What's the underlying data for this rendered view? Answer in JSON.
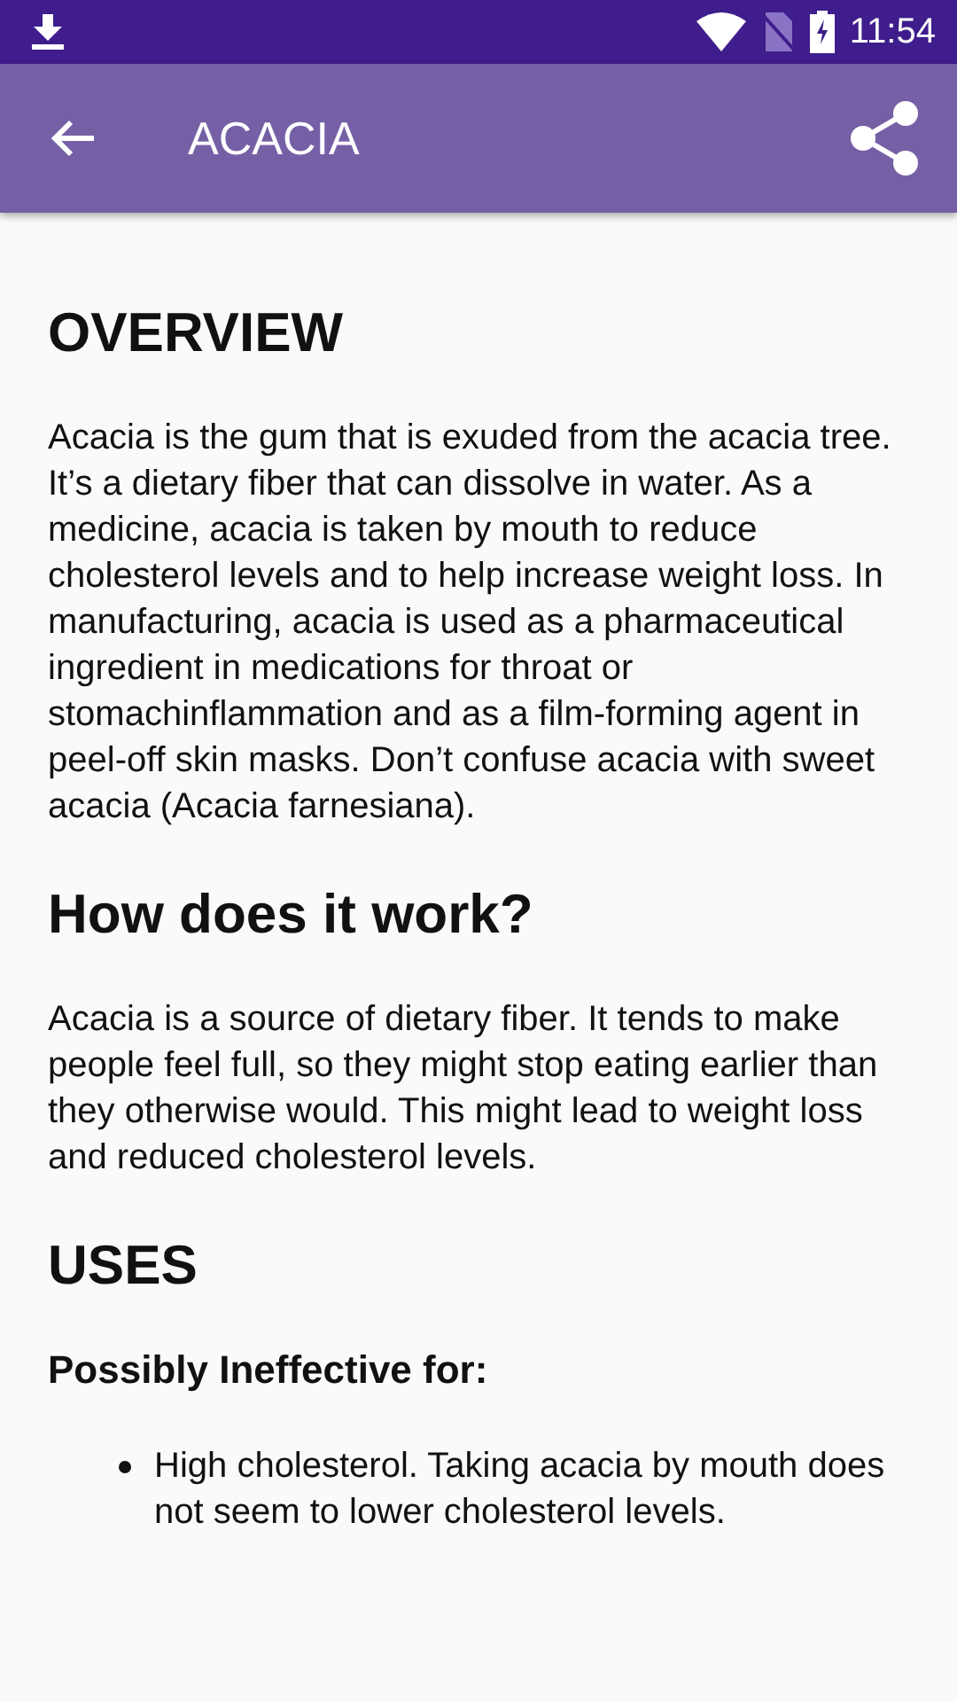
{
  "status_bar": {
    "time": "11:54"
  },
  "app_bar": {
    "title": "ACACIA"
  },
  "content": [
    {
      "kind": "heading",
      "text": "OVERVIEW"
    },
    {
      "kind": "paragraph",
      "text": "Acacia is the gum that is exuded from the acacia tree. It’s a dietary fiber that can dissolve in water. As a medicine, acacia is taken by mouth to reduce cholesterol levels and to help increase weight loss. In manufacturing, acacia is used as a pharmaceutical ingredient in medications for throat or stomachinflammation and as a film-forming agent in peel-off skin masks. Don’t confuse acacia with sweet acacia (Acacia farnesiana)."
    },
    {
      "kind": "heading",
      "text": "How does it work?"
    },
    {
      "kind": "paragraph",
      "text": "Acacia is a source of dietary fiber. It tends to make people feel full, so they might stop eating earlier than they otherwise would. This might lead to weight loss and reduced cholesterol levels."
    },
    {
      "kind": "heading",
      "text": "USES"
    },
    {
      "kind": "subheading",
      "text": "Possibly Ineffective for:"
    },
    {
      "kind": "bullet",
      "text": "High cholesterol. Taking acacia by mouth does not seem to lower cholesterol levels."
    }
  ]
}
